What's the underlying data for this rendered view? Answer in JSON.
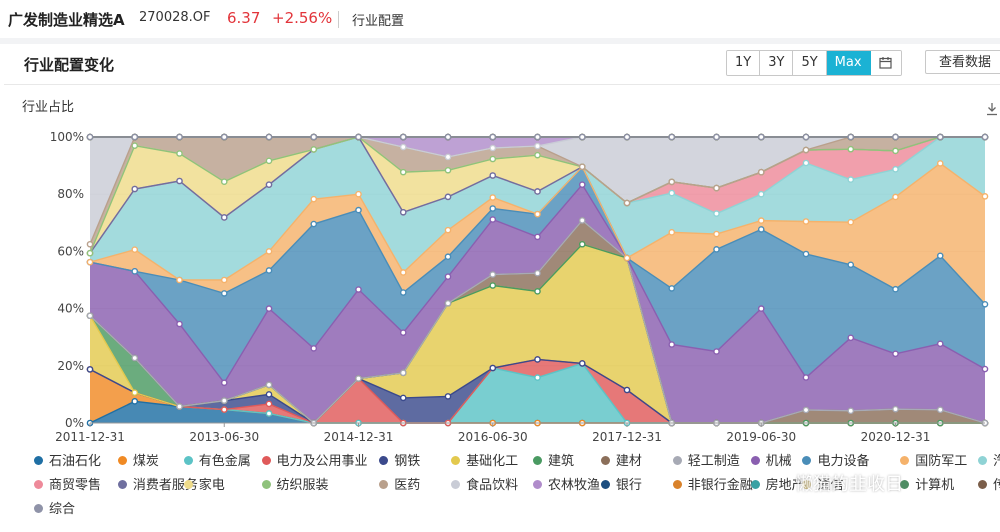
{
  "header": {
    "fund_name": "广发制造业精选A",
    "fund_code": "270028.OF",
    "nav": "6.37",
    "change": "+2.56%",
    "breadcrumb": "行业配置"
  },
  "card": {
    "title": "行业配置变化",
    "ranges": [
      "1Y",
      "3Y",
      "5Y",
      "Max"
    ],
    "active_range": "Max",
    "view_data_label": "查看数据",
    "calendar_icon": "calendar-icon",
    "download_icon": "download-icon"
  },
  "watermark": "懒猫的韭收日",
  "chart_data": {
    "type": "area",
    "stacked": true,
    "normalized": true,
    "ylabel": "行业占比",
    "ylim": [
      0,
      100
    ],
    "yticks": [
      "0%",
      "20%",
      "40%",
      "60%",
      "80%",
      "100%"
    ],
    "xticks": [
      "2011-12-31",
      "2013-06-30",
      "2014-12-31",
      "2016-06-30",
      "2017-12-31",
      "2019-06-30",
      "2020-12-31"
    ],
    "x": [
      "2011-12-31",
      "2012-06-30",
      "2012-12-31",
      "2013-06-30",
      "2013-12-31",
      "2014-06-30",
      "2014-12-31",
      "2015-06-30",
      "2015-12-31",
      "2016-06-30",
      "2016-12-31",
      "2017-06-30",
      "2017-12-31",
      "2018-06-30",
      "2018-12-31",
      "2019-06-30",
      "2019-12-31",
      "2020-06-30",
      "2020-12-31",
      "2021-06-30",
      "2021-12-31"
    ],
    "grid": true,
    "legend_position": "bottom",
    "series": [
      {
        "name": "石油石化",
        "color": "#1f6fa4",
        "values": [
          0,
          5,
          3,
          3,
          2,
          0,
          0,
          0,
          0,
          0,
          0,
          0,
          0,
          0,
          0,
          0,
          0,
          0,
          0,
          0,
          0
        ]
      },
      {
        "name": "煤炭",
        "color": "#f08a24",
        "values": [
          12,
          2,
          0,
          0,
          0,
          0,
          0,
          0,
          0,
          0,
          0,
          0,
          0,
          0,
          0,
          0,
          0,
          0,
          0,
          0,
          0
        ]
      },
      {
        "name": "有色金属",
        "color": "#5cc3c6",
        "values": [
          0,
          0,
          0,
          0,
          0,
          0,
          0,
          0,
          0,
          10,
          10,
          10,
          0,
          0,
          0,
          0,
          0,
          0,
          0,
          0,
          0
        ]
      },
      {
        "name": "电力及公用事业",
        "color": "#e05a5a",
        "values": [
          0,
          0,
          0,
          0,
          2,
          0,
          14,
          0,
          0,
          0,
          4,
          0,
          3,
          0,
          0,
          0,
          0,
          0,
          0,
          0,
          0
        ]
      },
      {
        "name": "钢铁",
        "color": "#3b4a8c",
        "values": [
          0,
          0,
          0,
          2,
          2,
          0,
          0,
          5,
          4,
          0,
          0,
          0,
          0,
          0,
          0,
          0,
          0,
          0,
          0,
          0,
          0
        ]
      },
      {
        "name": "基础化工",
        "color": "#e3c94e",
        "values": [
          12,
          0,
          0,
          0,
          2,
          0,
          0,
          5,
          14,
          15,
          15,
          20,
          12,
          0,
          0,
          0,
          0,
          0,
          0,
          0,
          0
        ]
      },
      {
        "name": "建筑",
        "color": "#4a9a62",
        "values": [
          0,
          8,
          0,
          0,
          0,
          0,
          0,
          0,
          0,
          0,
          0,
          0,
          0,
          0,
          0,
          0,
          0,
          0,
          0,
          0,
          0
        ]
      },
      {
        "name": "建材",
        "color": "#8b6f5a",
        "values": [
          0,
          0,
          0,
          0,
          0,
          0,
          0,
          0,
          0,
          2,
          4,
          4,
          0,
          0,
          0,
          0,
          2,
          2,
          3,
          3,
          0
        ]
      },
      {
        "name": "轻工制造",
        "color": "#a7aab5",
        "values": [
          0,
          0,
          0,
          0,
          0,
          0,
          0,
          0,
          0,
          0,
          0,
          0,
          0,
          0,
          0,
          0,
          0,
          0,
          0,
          0,
          0
        ]
      },
      {
        "name": "机械",
        "color": "#8a5fb0",
        "values": [
          12,
          20,
          15,
          4,
          16,
          12,
          28,
          8,
          4,
          10,
          8,
          6,
          0,
          14,
          14,
          26,
          5,
          12,
          12,
          15,
          10
        ]
      },
      {
        "name": "电力设备",
        "color": "#4a8db8",
        "values": [
          0,
          0,
          8,
          20,
          8,
          20,
          25,
          8,
          3,
          2,
          5,
          3,
          0,
          10,
          20,
          18,
          19,
          12,
          14,
          20,
          12
        ]
      },
      {
        "name": "国防军工",
        "color": "#f5b26b",
        "values": [
          0,
          5,
          0,
          3,
          4,
          4,
          5,
          4,
          4,
          2,
          0,
          0,
          0,
          10,
          3,
          2,
          5,
          7,
          20,
          21,
          20
        ]
      },
      {
        "name": "汽车",
        "color": "#8fd3d5",
        "values": [
          2,
          14,
          18,
          14,
          14,
          8,
          18,
          12,
          5,
          4,
          5,
          0,
          5,
          7,
          4,
          6,
          9,
          7,
          6,
          6,
          11
        ]
      },
      {
        "name": "商贸零售",
        "color": "#ee8a9a",
        "values": [
          0,
          0,
          0,
          0,
          0,
          0,
          0,
          0,
          0,
          0,
          0,
          0,
          0,
          2,
          5,
          5,
          2,
          5,
          4,
          0,
          0
        ]
      },
      {
        "name": "消费者服务",
        "color": "#6f6f9f",
        "values": [
          0,
          0,
          0,
          0,
          0,
          0,
          0,
          0,
          0,
          0,
          0,
          0,
          0,
          0,
          0,
          0,
          0,
          0,
          0,
          0,
          0
        ]
      },
      {
        "name": "家电",
        "color": "#efdc8a",
        "values": [
          0,
          10,
          5,
          8,
          5,
          0,
          0,
          8,
          4,
          3,
          8,
          0,
          0,
          0,
          0,
          0,
          0,
          0,
          0,
          0,
          0
        ]
      },
      {
        "name": "纺织服装",
        "color": "#8fc27c",
        "values": [
          0,
          0,
          0,
          0,
          0,
          0,
          0,
          0,
          0,
          0,
          0,
          0,
          0,
          0,
          0,
          0,
          0,
          0,
          0,
          0,
          0
        ]
      },
      {
        "name": "医药",
        "color": "#b9a08c",
        "values": [
          2,
          2,
          3,
          10,
          5,
          2,
          0,
          5,
          2,
          2,
          2,
          0,
          0,
          0,
          0,
          0,
          0,
          2,
          3,
          0,
          0
        ]
      },
      {
        "name": "食品饮料",
        "color": "#c9ccd6",
        "values": [
          24,
          0,
          0,
          0,
          0,
          0,
          0,
          0,
          0,
          0,
          0,
          5,
          6,
          8,
          10,
          8,
          2,
          0,
          0,
          0,
          0
        ]
      },
      {
        "name": "农林牧渔",
        "color": "#b08ccb",
        "values": [
          0,
          0,
          0,
          0,
          0,
          0,
          0,
          2,
          3,
          2,
          2,
          0,
          0,
          0,
          0,
          0,
          0,
          0,
          0,
          0,
          0
        ]
      },
      {
        "name": "银行",
        "color": "#1c4e80",
        "values": [
          0,
          0,
          0,
          0,
          0,
          0,
          0,
          0,
          0,
          0,
          0,
          0,
          0,
          0,
          0,
          0,
          0,
          0,
          0,
          0,
          0
        ]
      },
      {
        "name": "非银行金融",
        "color": "#d9822b",
        "values": [
          0,
          0,
          0,
          0,
          0,
          0,
          0,
          0,
          0,
          0,
          0,
          0,
          0,
          0,
          0,
          0,
          0,
          0,
          0,
          0,
          0
        ]
      },
      {
        "name": "房地产",
        "color": "#3aa1a3",
        "values": [
          0,
          0,
          0,
          0,
          0,
          0,
          0,
          0,
          0,
          0,
          0,
          0,
          0,
          0,
          0,
          0,
          0,
          0,
          0,
          0,
          0
        ]
      },
      {
        "name": "通信",
        "color": "#c9b26a",
        "values": [
          0,
          0,
          0,
          0,
          0,
          0,
          0,
          0,
          0,
          0,
          0,
          0,
          0,
          0,
          0,
          0,
          0,
          0,
          0,
          0,
          0
        ]
      },
      {
        "name": "计算机",
        "color": "#4e8c63",
        "values": [
          0,
          0,
          0,
          0,
          0,
          0,
          0,
          0,
          0,
          0,
          0,
          0,
          0,
          0,
          0,
          0,
          0,
          0,
          0,
          0,
          0
        ]
      },
      {
        "name": "传媒",
        "color": "#7b5e4a",
        "values": [
          0,
          0,
          0,
          0,
          0,
          0,
          0,
          0,
          0,
          0,
          0,
          0,
          0,
          0,
          0,
          0,
          0,
          0,
          0,
          0,
          0
        ]
      },
      {
        "name": "综合",
        "color": "#8f93a8",
        "values": [
          0,
          0,
          0,
          0,
          0,
          0,
          0,
          0,
          0,
          0,
          0,
          0,
          0,
          0,
          0,
          0,
          0,
          0,
          0,
          0,
          0
        ]
      }
    ]
  }
}
